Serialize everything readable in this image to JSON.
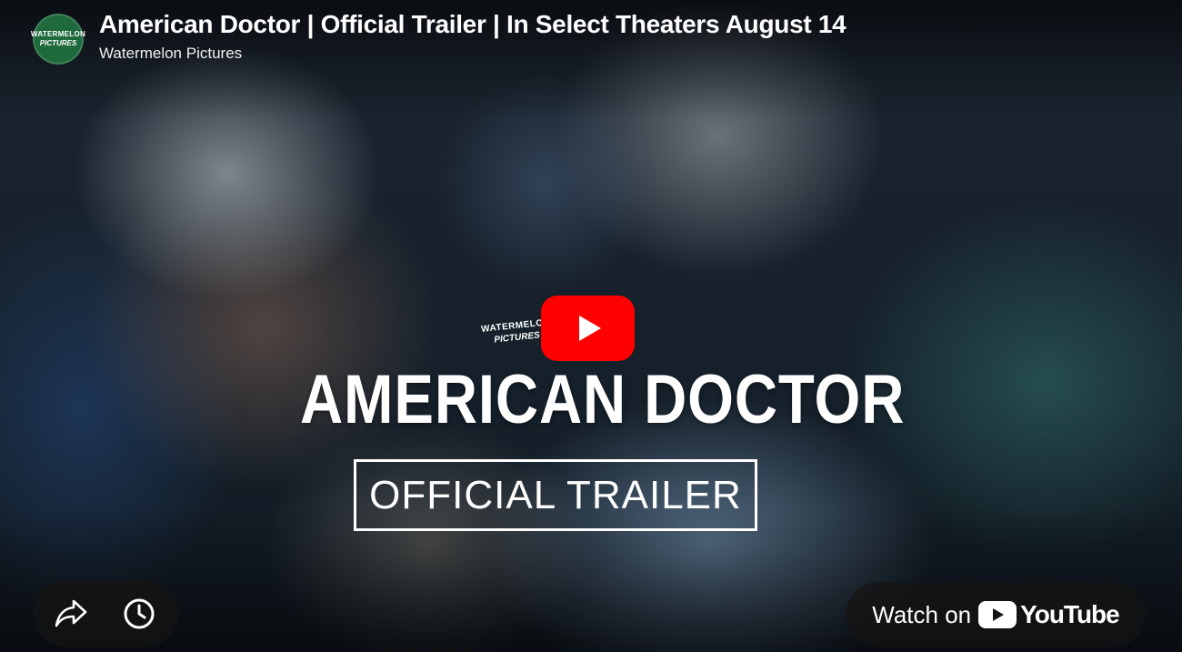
{
  "header": {
    "title": "American Doctor | Official Trailer | In Select Theaters August 14",
    "channel": "Watermelon Pictures",
    "avatar_logo_line1": "WATERMELON",
    "avatar_logo_line2": "PICTURES"
  },
  "thumbnail": {
    "studio_logo_line1": "WATERMELON",
    "studio_logo_line2": "PICTURES",
    "movie_title": "AMERICAN DOCTOR",
    "trailer_label": "OFFICIAL TRAILER"
  },
  "controls": {
    "play_icon": "play-icon",
    "share_icon": "share-icon",
    "watch_later_icon": "clock-icon"
  },
  "watch_on": {
    "label": "Watch on",
    "brand": "YouTube"
  },
  "colors": {
    "play_button": "#ff0000",
    "avatar_bg": "#1f6a3d",
    "overlay_pill": "#141414"
  }
}
